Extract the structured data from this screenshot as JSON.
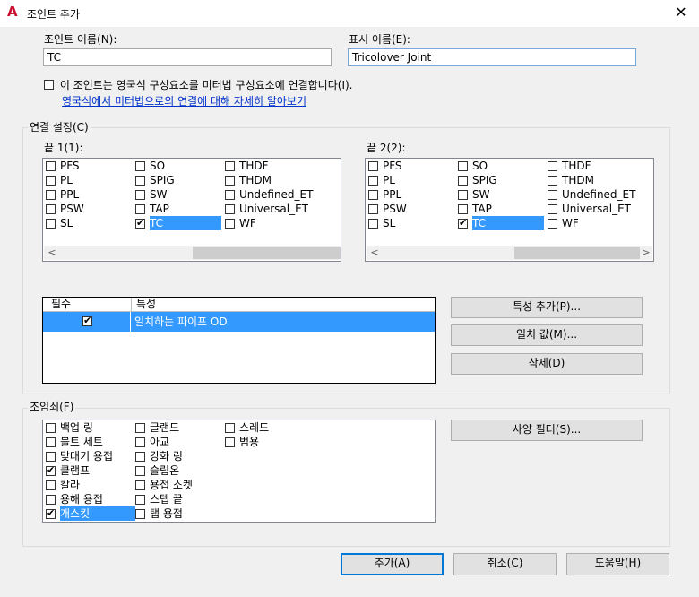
{
  "window": {
    "title": "조인트 추가",
    "close_glyph": "✕",
    "app_icon": "A"
  },
  "joint_name": {
    "label": "조인트 이름(N):",
    "value": "TC"
  },
  "display_name": {
    "label": "표시 이름(E):",
    "value": "Tricolover Joint"
  },
  "imperial_option": {
    "label": "이 조인트는 영국식 구성요소를 미터법 구성요소에 연결합니다(I).",
    "checked": false
  },
  "help_link": "영국식에서 미터법으로의 연결에 대해 자세히 알아보기",
  "connection": {
    "group_label": "연결 설정(C)",
    "end1": {
      "label": "끝 1(1):",
      "col1": [
        {
          "label": "PFS",
          "checked": false
        },
        {
          "label": "PL",
          "checked": false
        },
        {
          "label": "PPL",
          "checked": false
        },
        {
          "label": "PSW",
          "checked": false
        },
        {
          "label": "SL",
          "checked": false
        }
      ],
      "col2": [
        {
          "label": "SO",
          "checked": false
        },
        {
          "label": "SPIG",
          "checked": false
        },
        {
          "label": "SW",
          "checked": false
        },
        {
          "label": "TAP",
          "checked": false
        },
        {
          "label": "TC",
          "checked": true
        }
      ],
      "col3": [
        {
          "label": "THDF",
          "checked": false
        },
        {
          "label": "THDM",
          "checked": false
        },
        {
          "label": "Undefined_ET",
          "checked": false
        },
        {
          "label": "Universal_ET",
          "checked": false
        },
        {
          "label": "WF",
          "checked": false
        }
      ]
    },
    "end2": {
      "label": "끝 2(2):",
      "col1": [
        {
          "label": "PFS",
          "checked": false
        },
        {
          "label": "PL",
          "checked": false
        },
        {
          "label": "PPL",
          "checked": false
        },
        {
          "label": "PSW",
          "checked": false
        },
        {
          "label": "SL",
          "checked": false
        }
      ],
      "col2": [
        {
          "label": "SO",
          "checked": false
        },
        {
          "label": "SPIG",
          "checked": false
        },
        {
          "label": "SW",
          "checked": false
        },
        {
          "label": "TAP",
          "checked": false
        },
        {
          "label": "TC",
          "checked": true
        }
      ],
      "col3": [
        {
          "label": "THDF",
          "checked": false
        },
        {
          "label": "THDM",
          "checked": false
        },
        {
          "label": "Undefined_ET",
          "checked": false
        },
        {
          "label": "Universal_ET",
          "checked": false
        },
        {
          "label": "WF",
          "checked": false
        }
      ]
    },
    "properties_table": {
      "headers": [
        "필수",
        "특성"
      ],
      "rows": [
        {
          "required": true,
          "property": "일치하는 파이프 OD"
        }
      ]
    },
    "buttons": {
      "add_property": "특성 추가(P)...",
      "match_value": "일치 값(M)...",
      "delete": "삭제(D)"
    }
  },
  "fasteners": {
    "group_label": "조임쇠(F)",
    "col1": [
      {
        "label": "백업 링",
        "checked": false
      },
      {
        "label": "볼트 세트",
        "checked": false
      },
      {
        "label": "맞대기 용접",
        "checked": false
      },
      {
        "label": "클램프",
        "checked": true
      },
      {
        "label": "칼라",
        "checked": false
      },
      {
        "label": "용해 용접",
        "checked": false
      },
      {
        "label": "개스킷",
        "checked": true
      }
    ],
    "col2": [
      {
        "label": "글랜드",
        "checked": false
      },
      {
        "label": "아교",
        "checked": false
      },
      {
        "label": "강화 링",
        "checked": false
      },
      {
        "label": "슬립온",
        "checked": false
      },
      {
        "label": "용접 소켓",
        "checked": false
      },
      {
        "label": "스텝 끝",
        "checked": false
      },
      {
        "label": "탭 용접",
        "checked": false
      }
    ],
    "col3": [
      {
        "label": "스레드",
        "checked": false
      },
      {
        "label": "범용",
        "checked": false
      }
    ],
    "spec_filter_button": "사양 필터(S)..."
  },
  "footer": {
    "add": "추가(A)",
    "cancel": "취소(C)",
    "help": "도움말(H)"
  }
}
